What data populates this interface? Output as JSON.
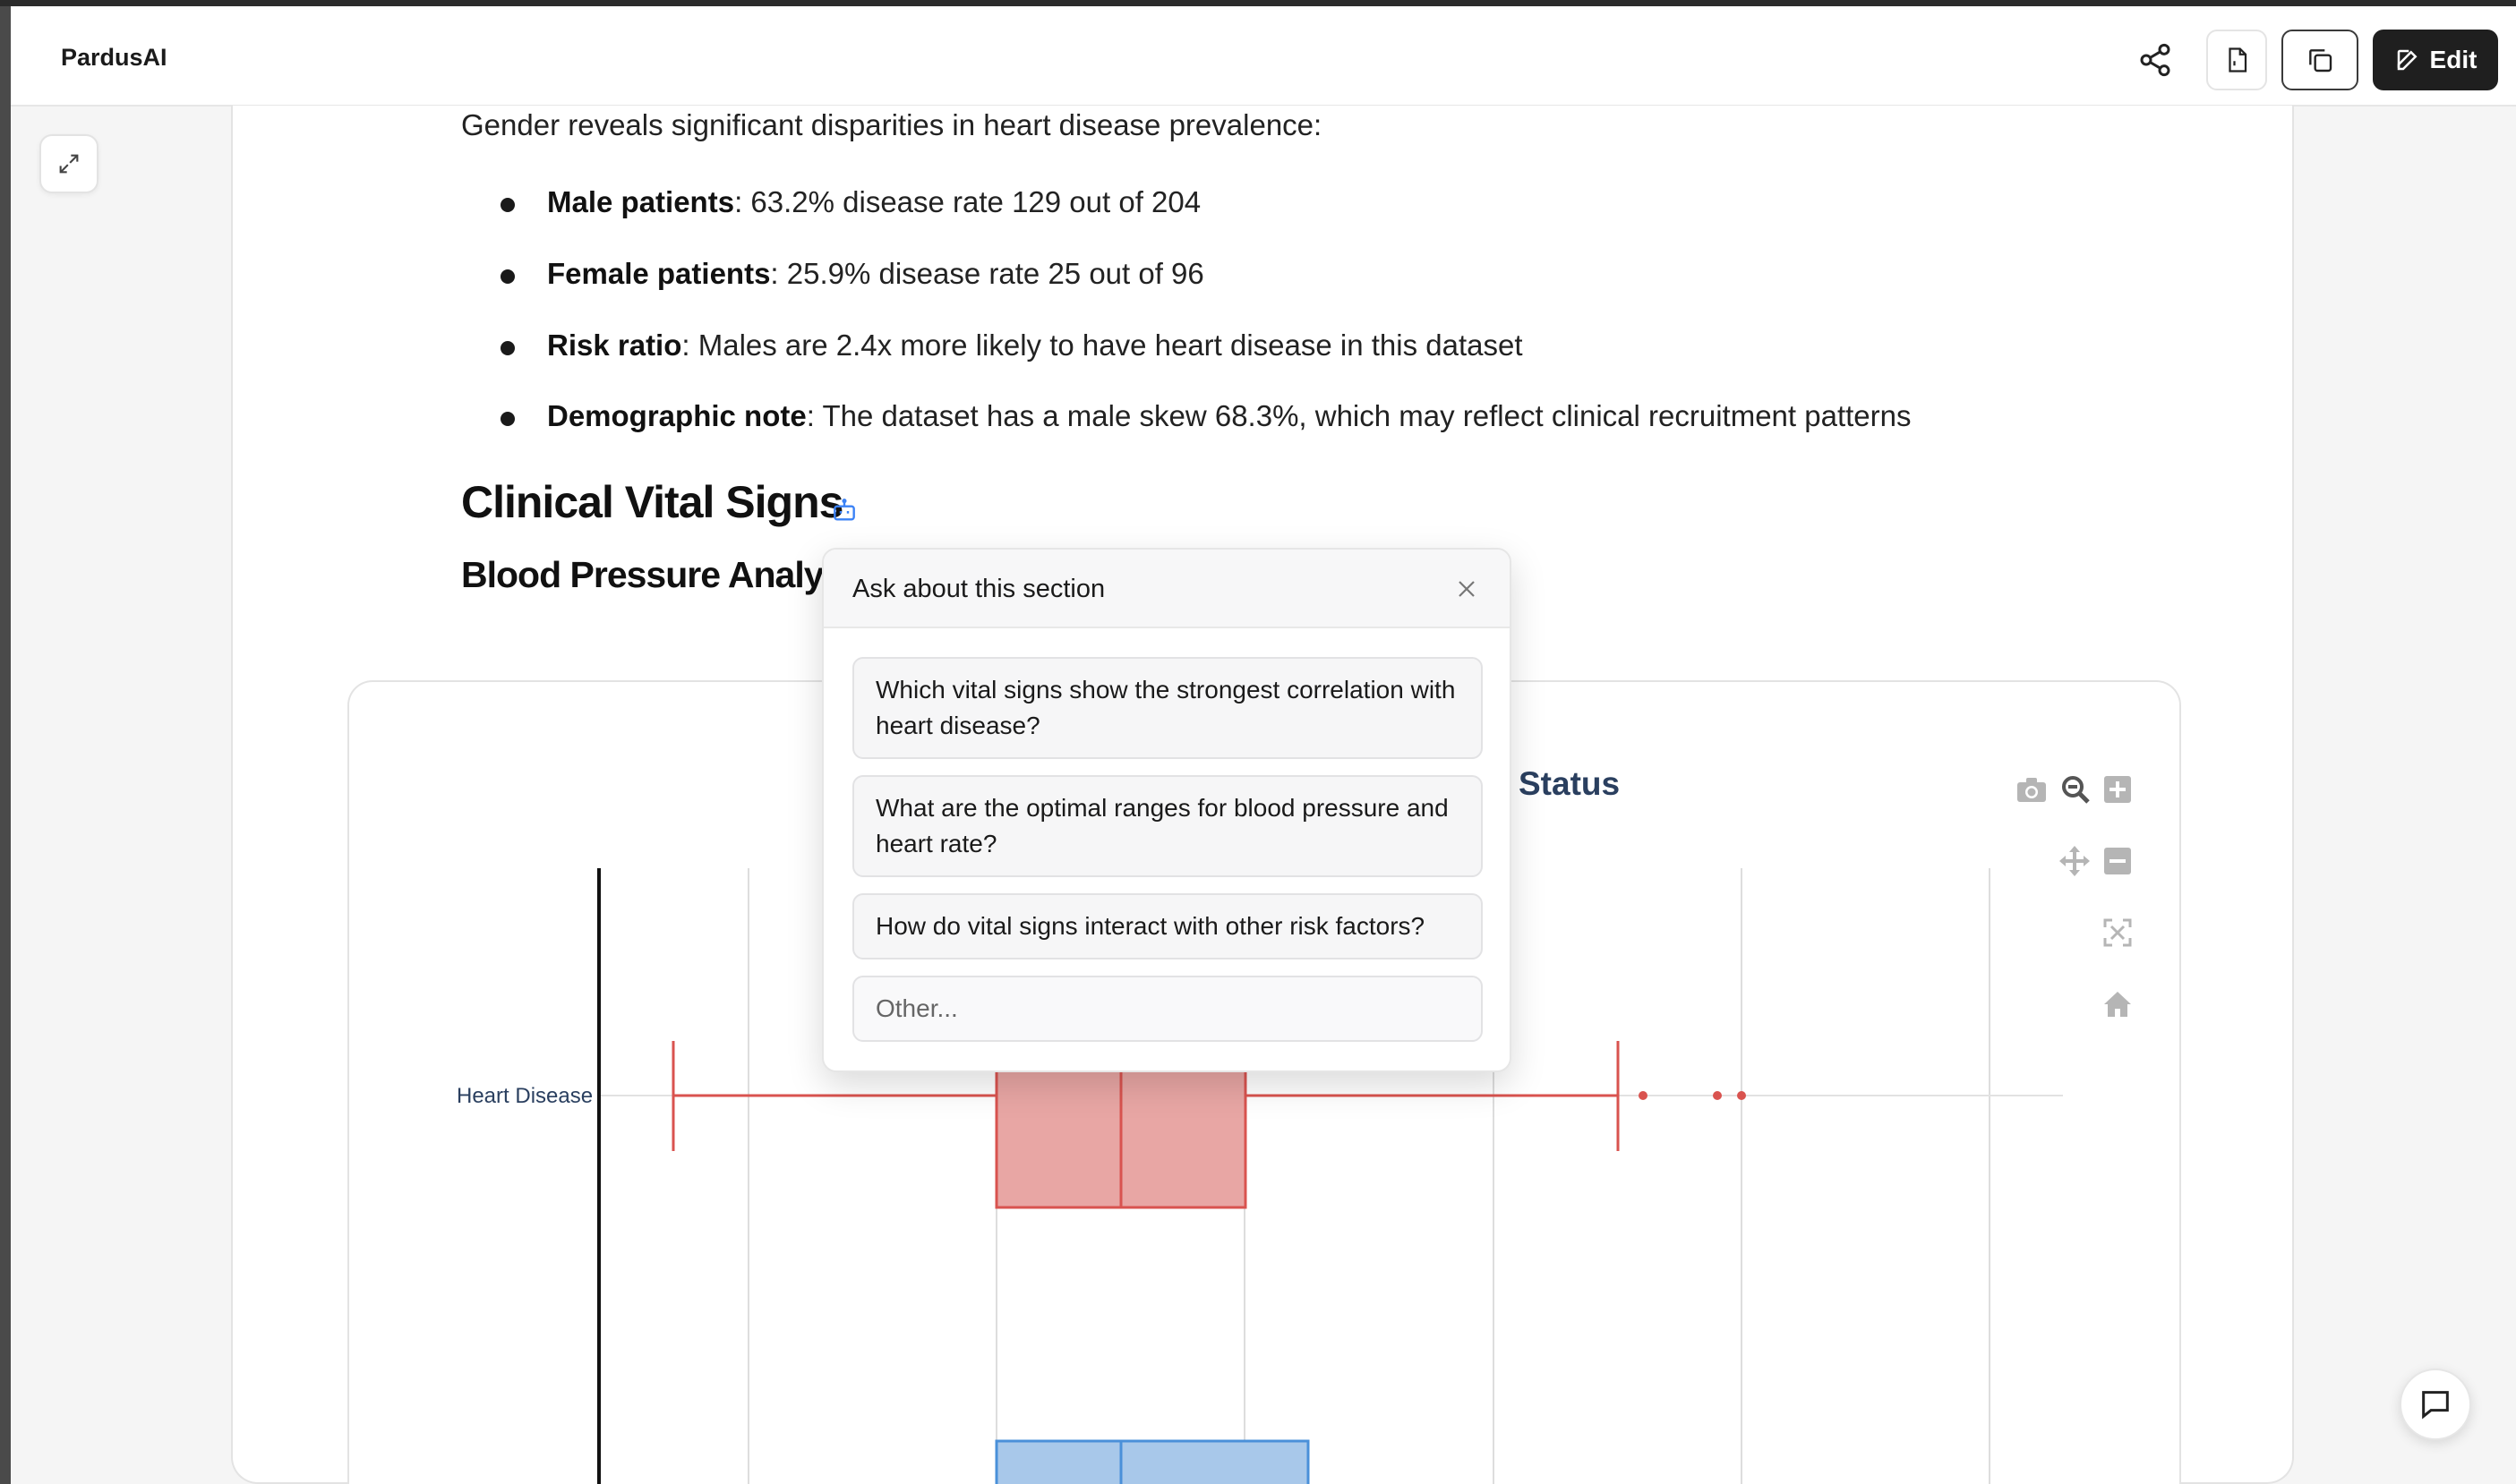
{
  "app": {
    "brand": "PardusAI"
  },
  "toolbar": {
    "share_icon": "share-icon",
    "file_icon": "file-export-icon",
    "copy_icon": "copy-icon",
    "edit_label": "Edit",
    "edit_icon": "edit-icon"
  },
  "content": {
    "intro": "Gender reveals significant disparities in heart disease prevalence:",
    "bullets": [
      {
        "term": "Male patients",
        "text": ": 63.2% disease rate 129 out of 204"
      },
      {
        "term": "Female patients",
        "text": ": 25.9% disease rate 25 out of 96"
      },
      {
        "term": "Risk ratio",
        "text": ": Males are 2.4x more likely to have heart disease in this dataset"
      },
      {
        "term": "Demographic note",
        "text": ": The dataset has a male skew 68.3%, which may reflect clinical recruitment patterns"
      }
    ],
    "section_heading": "Clinical Vital Signs",
    "subsection_heading": "Blood Pressure Analysis"
  },
  "chart": {
    "title_visible": "Status",
    "y_tick": "Heart Disease",
    "colors": {
      "heart_disease": "#d9534f",
      "heart_disease_fill": "#e8a6a4",
      "no_disease_fill": "#a8c8ea",
      "no_disease_line": "#4a90d9",
      "title": "#2a3f5f"
    },
    "modebar": [
      "camera-icon",
      "zoom-icon",
      "zoom-in-icon",
      "pan-icon",
      "zoom-out-icon",
      "autoscale-icon",
      "reset-home-icon"
    ]
  },
  "chart_data": {
    "type": "box",
    "orientation": "horizontal",
    "categories": [
      "Heart Disease"
    ],
    "series": [
      {
        "name": "Heart Disease",
        "color": "#d9534f"
      }
    ],
    "grid": true
  },
  "popup": {
    "title": "Ask about this section",
    "suggestions": [
      "Which vital signs show the strongest correlation with heart disease?",
      "What are the optimal ranges for blood pressure and heart rate?",
      "How do vital signs interact with other risk factors?"
    ],
    "other_placeholder": "Other..."
  }
}
